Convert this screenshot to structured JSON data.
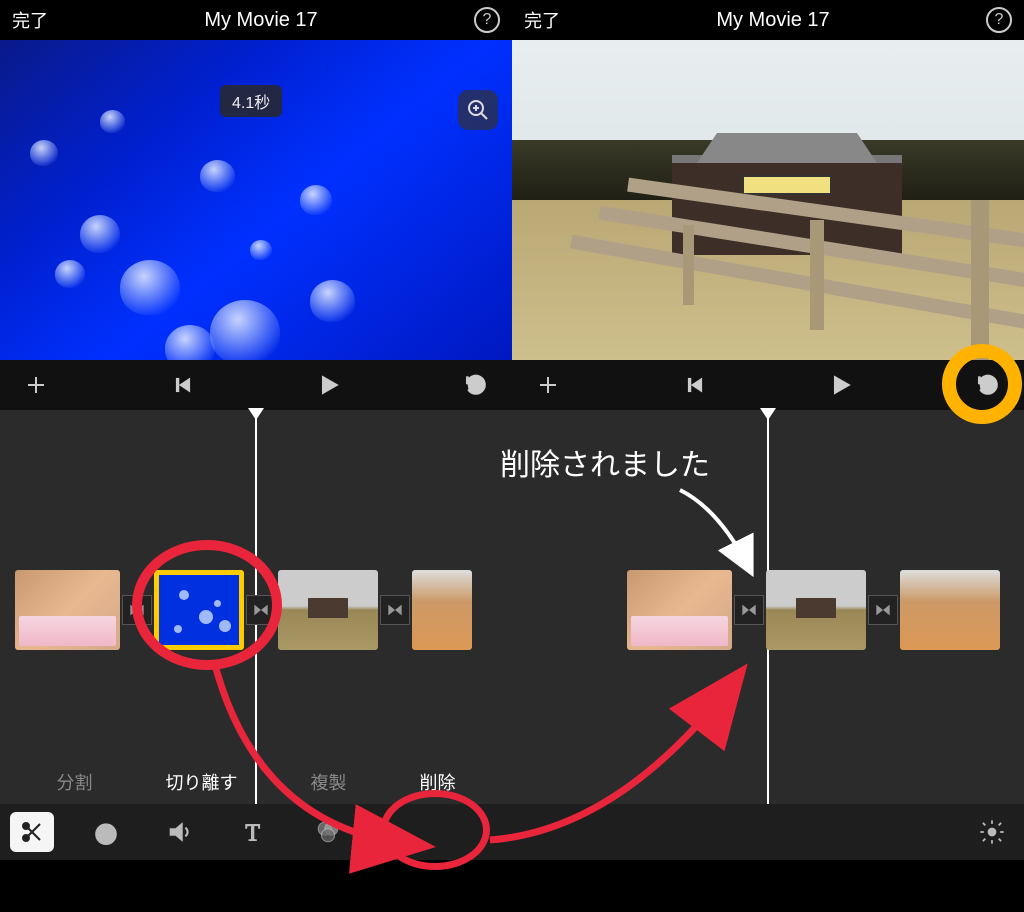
{
  "header": {
    "done": "完了",
    "title": "My Movie 17"
  },
  "preview": {
    "duration_badge": "4.1秒"
  },
  "edit_tabs": {
    "split": "分割",
    "detach": "切り離す",
    "duplicate": "複製",
    "delete": "削除"
  },
  "annotations": {
    "deleted_text": "削除されました"
  }
}
